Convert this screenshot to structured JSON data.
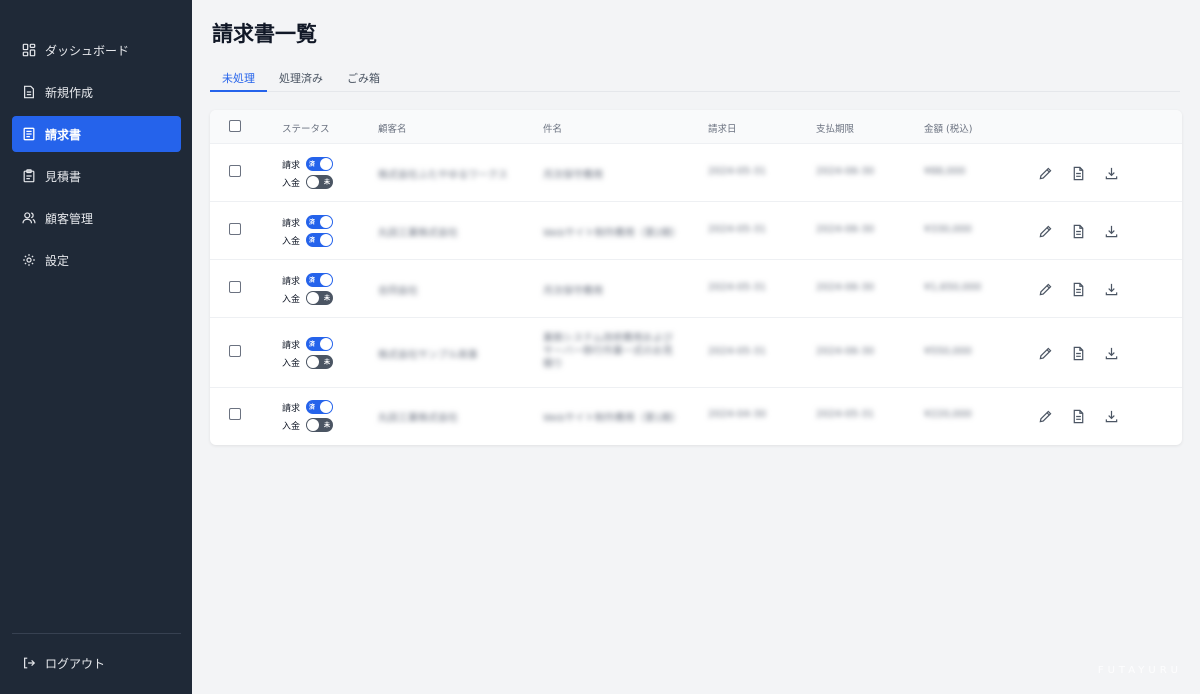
{
  "sidebar": {
    "items": [
      {
        "label": "ダッシュボード",
        "icon": "dashboard-icon",
        "active": false
      },
      {
        "label": "新規作成",
        "icon": "new-document-icon",
        "active": false
      },
      {
        "label": "請求書",
        "icon": "invoice-icon",
        "active": true
      },
      {
        "label": "見積書",
        "icon": "estimate-icon",
        "active": false
      },
      {
        "label": "顧客管理",
        "icon": "users-icon",
        "active": false
      },
      {
        "label": "設定",
        "icon": "gear-icon",
        "active": false
      }
    ],
    "logout_label": "ログアウト"
  },
  "page": {
    "title": "請求書一覧"
  },
  "tabs": [
    {
      "label": "未処理",
      "active": true
    },
    {
      "label": "処理済み",
      "active": false
    },
    {
      "label": "ごみ箱",
      "active": false
    }
  ],
  "table": {
    "headers": {
      "status": "ステータス",
      "customer": "顧客名",
      "subject": "件名",
      "invoice_date": "請求日",
      "due_date": "支払期限",
      "amount": "金額 (税込)"
    },
    "status_labels": {
      "billing": "請求",
      "payment": "入金"
    },
    "toggle_text": {
      "on": "済",
      "off": "未"
    },
    "rows": [
      {
        "billing": true,
        "payment": false,
        "customer": "株式会社ふたやゆるワークス",
        "subject": "月次保守費用",
        "invoice_date": "2024-05-31",
        "due_date": "2024-06-30",
        "amount": "¥88,000"
      },
      {
        "billing": true,
        "payment": true,
        "customer": "丸田工業株式会社",
        "subject": "Webサイト制作費用（第2期）",
        "invoice_date": "2024-05-31",
        "due_date": "2024-06-30",
        "amount": "¥330,000"
      },
      {
        "billing": true,
        "payment": false,
        "customer": "合同会社",
        "subject": "月次保守費用",
        "invoice_date": "2024-05-31",
        "due_date": "2024-06-30",
        "amount": "¥1,650,000"
      },
      {
        "billing": true,
        "payment": false,
        "customer": "株式会社サンプル商事",
        "subject": "業務システム改修費用およびサーバー移行作業一式のお見積り",
        "invoice_date": "2024-05-31",
        "due_date": "2024-06-30",
        "amount": "¥550,000"
      },
      {
        "billing": true,
        "payment": false,
        "customer": "丸田工業株式会社",
        "subject": "Webサイト制作費用（第1期）",
        "invoice_date": "2024-04-30",
        "due_date": "2024-05-31",
        "amount": "¥220,000"
      }
    ]
  },
  "brand": "FUTAYURU",
  "colors": {
    "sidebar": "#1f2937",
    "accent": "#2563eb",
    "toggle_off": "#4b5563"
  }
}
